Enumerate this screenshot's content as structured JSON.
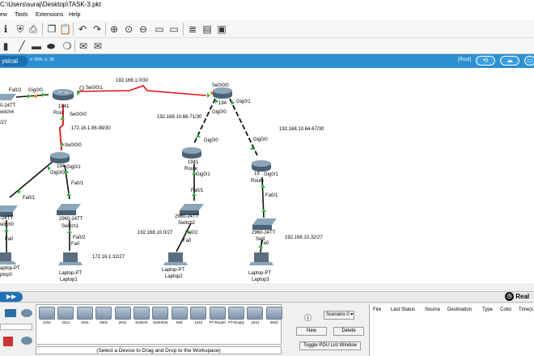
{
  "window": {
    "title": "C:\\Users\\suraj\\Desktop\\TASK-3.pkt"
  },
  "menu": [
    "ew",
    "Tools",
    "Extensions",
    "Help"
  ],
  "topbar": {
    "tab": "ysical",
    "coords": "x: 504, y: 30",
    "root": "[Root]"
  },
  "labels": {
    "net_top": "192.168.1.0/30",
    "net_left_serial": "172.16.1.96-99/30",
    "net_mid": "192.168.10.68-71/30",
    "net_right": "192.168.10.64-67/30",
    "net_left_lan": "172.16.1.32/27",
    "net_mid_lan": "192.168.10.0/27",
    "net_right_lan": "192.168.10.32/27",
    "frag_27": "/27"
  },
  "ports": {
    "fa02": "Fa0/2",
    "gig00_r0": "Gig0/0",
    "se001_r0": "Se0/0/1",
    "se000_r0": "Se0/0/0",
    "se000_r1": "Se0/0/0",
    "gig00_r1": "Gig0/0",
    "gig01_r1": "Gig0/1",
    "fa01_s0": "Fa0/1",
    "fa01_s1": "Fa0/1",
    "fa0_s0": "Fa0",
    "fa02_s1": "Fa0/2",
    "fa0_l1": "Fa0",
    "se000_r3": "Se0/0/0",
    "gig01_r3": "Gig0/1",
    "gig00_r3": "Gig0/0",
    "gig00_r2": "Gig0/0",
    "gig01_r2": "Gig0/1",
    "fa01_s2": "Fa0/1",
    "fa02_s2": "Fa0/2",
    "fa0_l2": "Fa0",
    "gig00_r4": "Gig0/0",
    "gig01_r4": "Gig0/1",
    "fa01_s3": "Fa0/1",
    "fa0_l3": "Fa0"
  },
  "devices": {
    "switch4": {
      "model": "0-24TT",
      "name": "witch4"
    },
    "router0": {
      "model": "1941",
      "name": "Rout"
    },
    "router1": {
      "model": "194"
    },
    "router_top": {
      "model": "194"
    },
    "router2": {
      "model": "1941",
      "name": "Route"
    },
    "router4": {
      "model": "19",
      "name": "Route"
    },
    "switch0": {
      "model": "-24TT",
      "name": "witch0"
    },
    "switch1": {
      "model": "2960-24TT",
      "name": "Switch1"
    },
    "switch2": {
      "model": "2960-24TT",
      "name": "Switch2"
    },
    "switch3": {
      "model": "2960-24TT",
      "name": "Swit"
    },
    "laptop0": {
      "model": "aptop-PT",
      "name": "ptop0"
    },
    "laptop1": {
      "model": "Laptop-PT",
      "name": "Laptop1"
    },
    "laptop2": {
      "model": "Laptop-PT",
      "name": "Laptop2"
    },
    "laptop3": {
      "model": "Laptop-PT",
      "name": "Laptop3"
    }
  },
  "device_palette": [
    "4331",
    "4321",
    "1941",
    "2901",
    "2911",
    "819IOX",
    "819HGW",
    "829",
    "1240",
    "PT-Router",
    "PT-Empty",
    "1841",
    "2620"
  ],
  "device_caption": "(Select a Device to Drag and Drop to the Workspace)",
  "scenario": {
    "select": "Scenario 0",
    "new": "New",
    "delete": "Delete",
    "toggle": "Toggle PDU List Window"
  },
  "pdu_columns": [
    "Fire",
    "Last Status",
    "Source",
    "Destination",
    "Type",
    "Color",
    "Time(s"
  ],
  "realtime": "Real",
  "colors": {
    "accent": "#2c8fd0",
    "serial_link": "#e01010",
    "ethernet": "#111111"
  }
}
